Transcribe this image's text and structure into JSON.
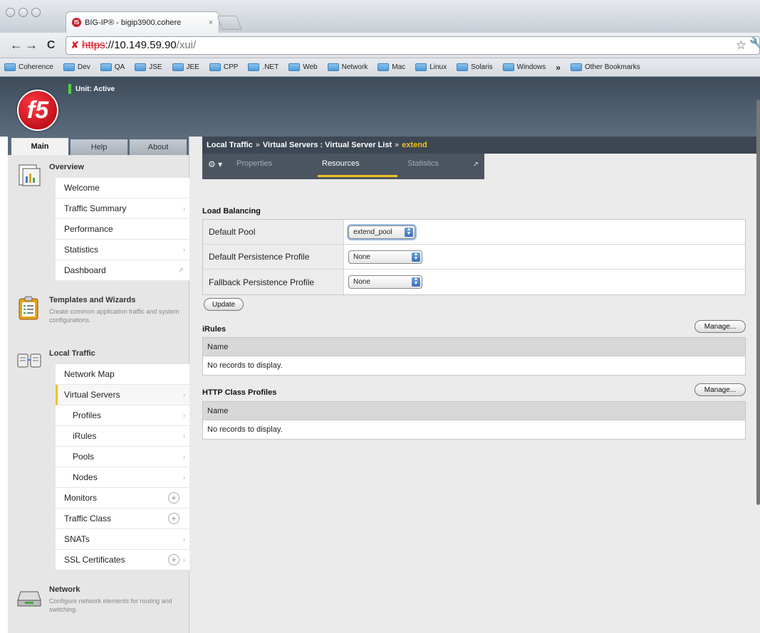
{
  "browser": {
    "tab_title": "BIG-IP® - bigip3900.cohere",
    "tab_close": "×",
    "url_scheme": "https",
    "url_host": "://10.149.59.90",
    "url_path": "/xui/",
    "bookmarks": [
      "Coherence",
      "Dev",
      "QA",
      "JSE",
      "JEE",
      "CPP",
      ".NET",
      "Web",
      "Network",
      "Mac",
      "Linux",
      "Solaris",
      "Windows"
    ],
    "bookmarks_overflow": "»",
    "other_bookmarks": "Other Bookmarks"
  },
  "header": {
    "logo_text": "f5",
    "unit_status": "Unit: Active"
  },
  "leftnav": {
    "tabs": [
      "Main",
      "Help",
      "About"
    ],
    "overview": {
      "title": "Overview",
      "items": [
        "Welcome",
        "Traffic Summary",
        "Performance",
        "Statistics",
        "Dashboard"
      ]
    },
    "templates": {
      "title": "Templates and Wizards",
      "description": "Create common application traffic and system configurations."
    },
    "local_traffic": {
      "title": "Local Traffic",
      "items": [
        "Network Map",
        "Virtual Servers",
        "Profiles",
        "iRules",
        "Pools",
        "Nodes",
        "Monitors",
        "Traffic Class",
        "SNATs",
        "SSL Certificates"
      ]
    },
    "network": {
      "title": "Network",
      "description": "Configure network elements for routing and switching."
    }
  },
  "main": {
    "breadcrumb": {
      "part1": "Local Traffic",
      "sep": "»",
      "part2": "Virtual Servers : Virtual Server List",
      "current": "extend"
    },
    "tabs": [
      "Properties",
      "Resources",
      "Statistics"
    ],
    "active_tab": "Resources",
    "load_balancing": {
      "heading": "Load Balancing",
      "rows": [
        {
          "label": "Default Pool",
          "value": "extend_pool"
        },
        {
          "label": "Default Persistence Profile",
          "value": "None"
        },
        {
          "label": "Fallback Persistence Profile",
          "value": "None"
        }
      ],
      "update_label": "Update"
    },
    "irules": {
      "heading": "iRules",
      "manage_label": "Manage...",
      "column": "Name",
      "empty": "No records to display."
    },
    "http_class": {
      "heading": "HTTP Class Profiles",
      "manage_label": "Manage...",
      "column": "Name",
      "empty": "No records to display."
    }
  },
  "colors": {
    "accent": "#f1c21b",
    "header_bg": "#3e4c5b",
    "status_active": "#4fcf3f"
  }
}
